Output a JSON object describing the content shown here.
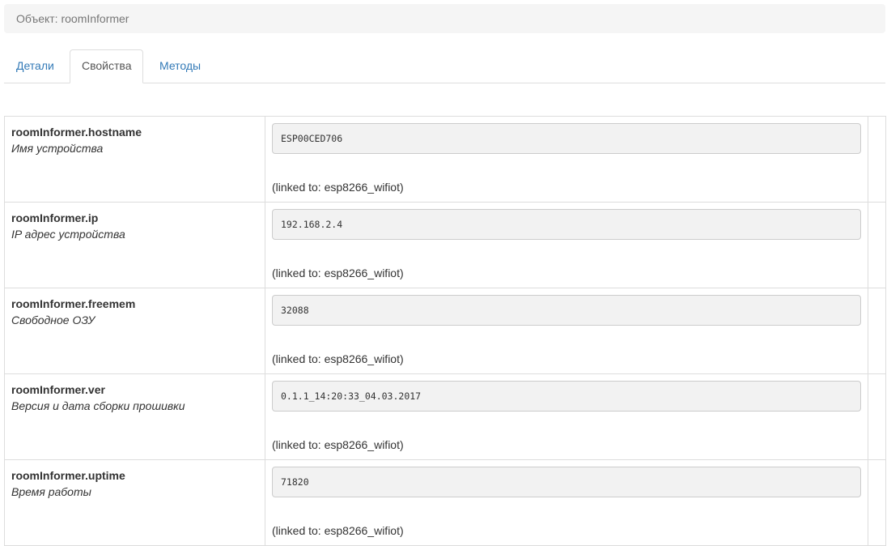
{
  "breadcrumb": {
    "text": "Объект: roomInformer"
  },
  "tabs": [
    {
      "label": "Детали",
      "active": false
    },
    {
      "label": "Свойства",
      "active": true
    },
    {
      "label": "Методы",
      "active": false
    }
  ],
  "colors": {
    "link": "#337ab7",
    "border": "#dddddd",
    "input_bg": "#f2f2f2",
    "breadcrumb_bg": "#f5f5f5"
  },
  "properties": [
    {
      "name": "roomInformer.hostname",
      "description": "Имя устройства",
      "value": "ESP00CED706",
      "linked": "(linked to: esp8266_wifiot)"
    },
    {
      "name": "roomInformer.ip",
      "description": "IP адрес устройства",
      "value": "192.168.2.4",
      "linked": "(linked to: esp8266_wifiot)"
    },
    {
      "name": "roomInformer.freemem",
      "description": "Свободное ОЗУ",
      "value": "32088",
      "linked": "(linked to: esp8266_wifiot)"
    },
    {
      "name": "roomInformer.ver",
      "description": "Версия и дата сборки прошивки",
      "value": "0.1.1_14:20:33_04.03.2017",
      "linked": "(linked to: esp8266_wifiot)"
    },
    {
      "name": "roomInformer.uptime",
      "description": "Время работы",
      "value": "71820",
      "linked": "(linked to: esp8266_wifiot)"
    }
  ]
}
